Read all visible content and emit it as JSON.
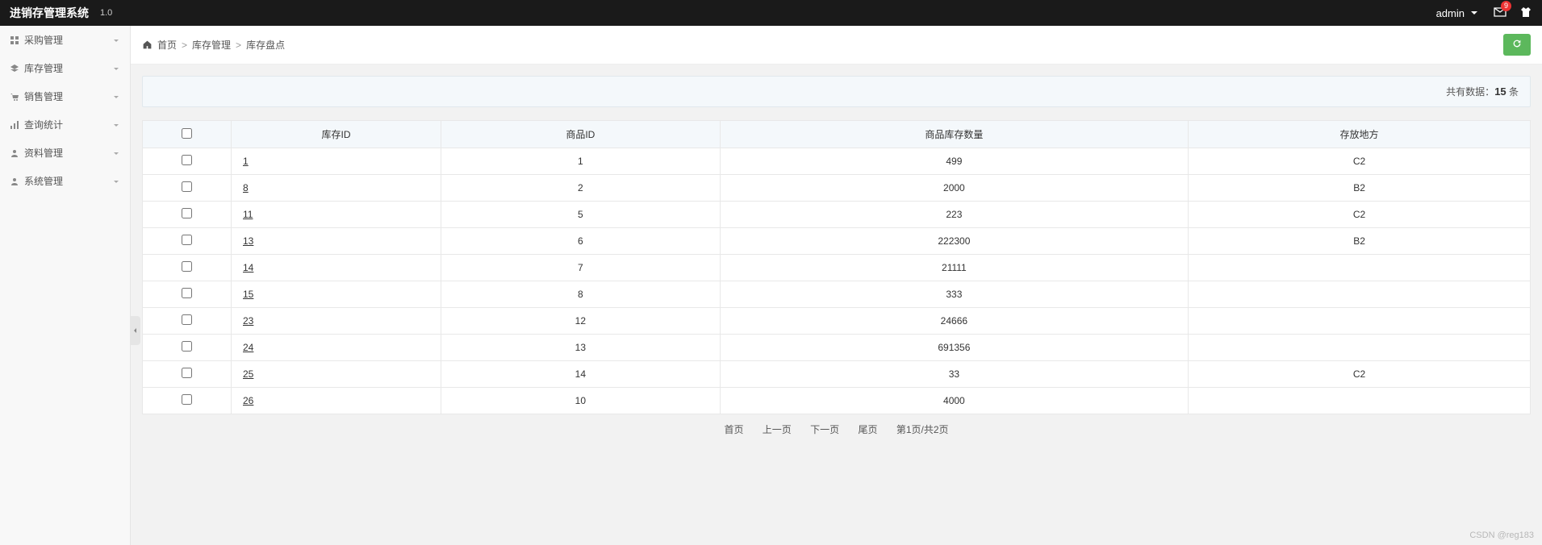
{
  "header": {
    "app_title": "进销存管理系统",
    "version": "1.0",
    "user": "admin",
    "mail_badge": "9"
  },
  "sidebar": {
    "items": [
      {
        "label": "采购管理",
        "icon": "grid"
      },
      {
        "label": "库存管理",
        "icon": "layers"
      },
      {
        "label": "销售管理",
        "icon": "cart"
      },
      {
        "label": "查询统计",
        "icon": "bars"
      },
      {
        "label": "资料管理",
        "icon": "user"
      },
      {
        "label": "系统管理",
        "icon": "person"
      }
    ]
  },
  "breadcrumb": {
    "home": "首页",
    "l1": "库存管理",
    "l2": "库存盘点"
  },
  "summary": {
    "prefix": "共有数据：",
    "count": "15",
    "suffix": " 条"
  },
  "table": {
    "headers": {
      "stock_id": "库存ID",
      "goods_id": "商品ID",
      "qty": "商品库存数量",
      "loc": "存放地方"
    },
    "rows": [
      {
        "stock_id": "1",
        "goods_id": "1",
        "qty": "499",
        "loc": "C2"
      },
      {
        "stock_id": "8",
        "goods_id": "2",
        "qty": "2000",
        "loc": "B2"
      },
      {
        "stock_id": "11",
        "goods_id": "5",
        "qty": "223",
        "loc": "C2"
      },
      {
        "stock_id": "13",
        "goods_id": "6",
        "qty": "222300",
        "loc": "B2"
      },
      {
        "stock_id": "14",
        "goods_id": "7",
        "qty": "21111",
        "loc": ""
      },
      {
        "stock_id": "15",
        "goods_id": "8",
        "qty": "333",
        "loc": ""
      },
      {
        "stock_id": "23",
        "goods_id": "12",
        "qty": "24666",
        "loc": ""
      },
      {
        "stock_id": "24",
        "goods_id": "13",
        "qty": "691356",
        "loc": ""
      },
      {
        "stock_id": "25",
        "goods_id": "14",
        "qty": "33",
        "loc": "C2"
      },
      {
        "stock_id": "26",
        "goods_id": "10",
        "qty": "4000",
        "loc": ""
      }
    ]
  },
  "pager": {
    "first": "首页",
    "prev": "上一页",
    "next": "下一页",
    "last": "尾页",
    "info": "第1页/共2页"
  },
  "watermark": "CSDN @reg183"
}
